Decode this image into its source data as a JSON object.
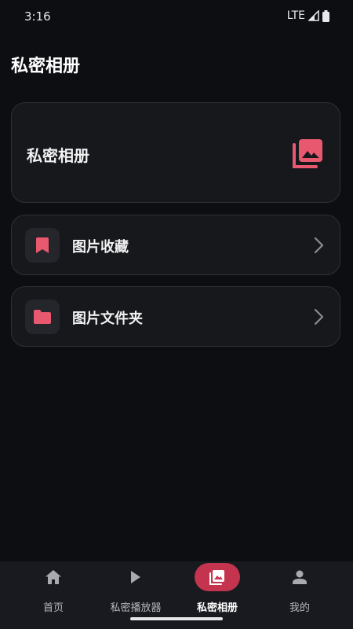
{
  "status": {
    "time": "3:16",
    "network": "LTE"
  },
  "page": {
    "title": "私密相册"
  },
  "hero_card": {
    "label": "私密相册",
    "icon": "photo-library-icon"
  },
  "rows": [
    {
      "label": "图片收藏",
      "icon": "bookmark-icon"
    },
    {
      "label": "图片文件夹",
      "icon": "folder-icon"
    }
  ],
  "nav": {
    "items": [
      {
        "label": "首页",
        "icon": "home-icon",
        "active": false
      },
      {
        "label": "私密播放器",
        "icon": "play-icon",
        "active": false
      },
      {
        "label": "私密相册",
        "icon": "photo-library-icon",
        "active": true
      },
      {
        "label": "我的",
        "icon": "person-icon",
        "active": false
      }
    ]
  },
  "colors": {
    "accent": "#e8586f",
    "background": "#0d0e11",
    "card": "#17181c",
    "active_tab": "#c4344f"
  }
}
